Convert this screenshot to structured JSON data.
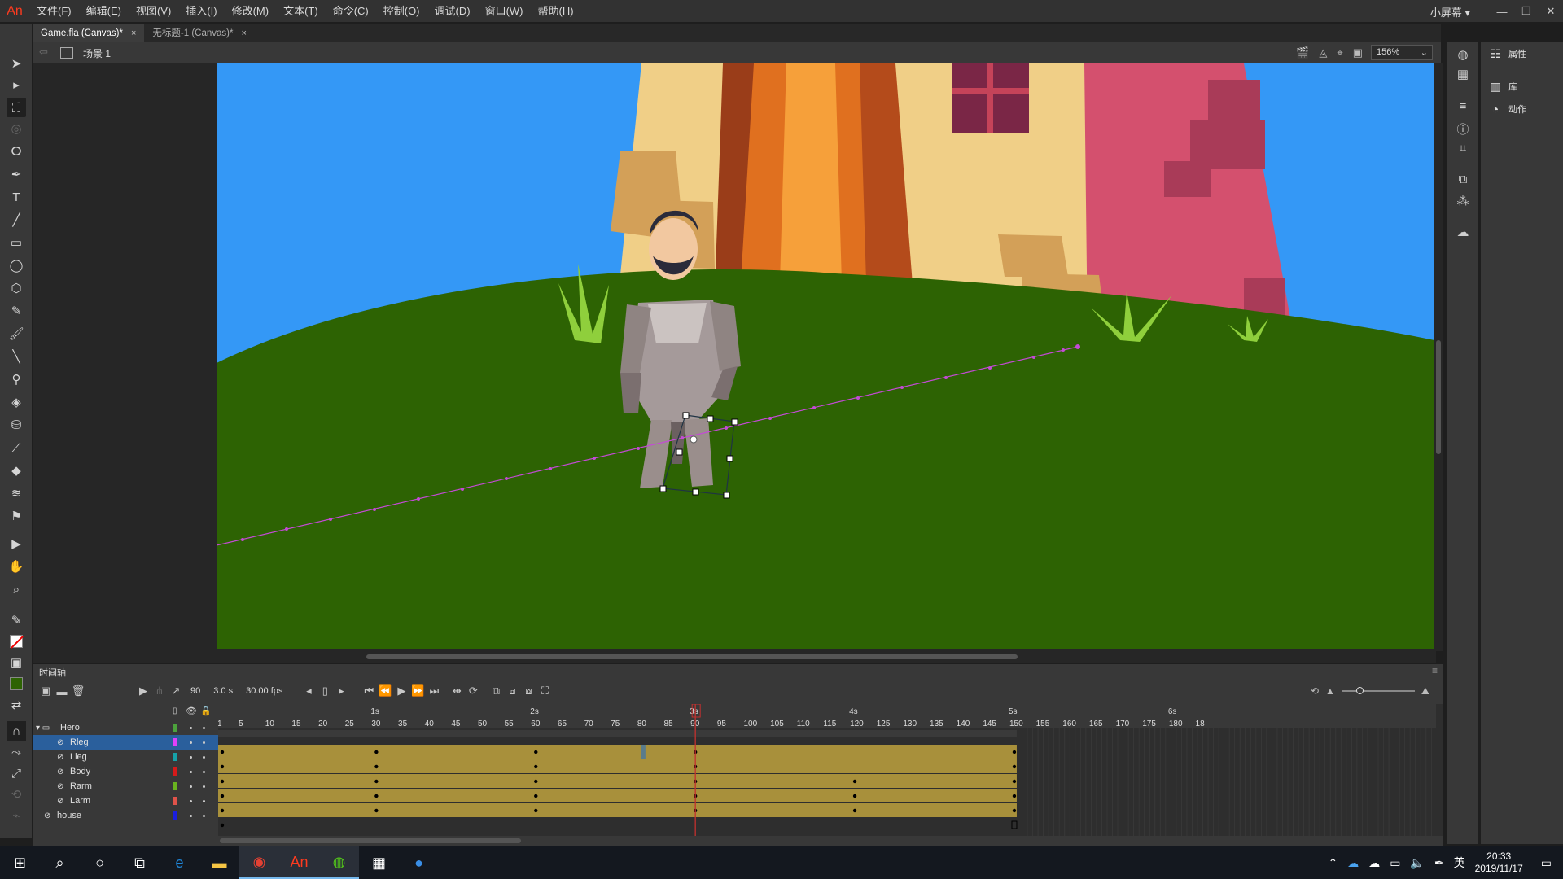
{
  "app": {
    "logo": "An"
  },
  "menu": [
    "文件(F)",
    "编辑(E)",
    "视图(V)",
    "插入(I)",
    "修改(M)",
    "文本(T)",
    "命令(C)",
    "控制(O)",
    "调试(D)",
    "窗口(W)",
    "帮助(H)"
  ],
  "workspace": "小屏幕",
  "window_buttons": [
    "—",
    "❐",
    "✕"
  ],
  "tabs": [
    {
      "label": "Game.fla (Canvas)*",
      "active": true
    },
    {
      "label": "无标题-1 (Canvas)*",
      "active": false
    }
  ],
  "tab_close": "×",
  "scene": {
    "label": "场景 1",
    "zoom": "156%"
  },
  "right_panel": {
    "items": [
      "属性",
      "库",
      "动作"
    ]
  },
  "timeline": {
    "title": "时间轴",
    "current_frame": "90",
    "time": "3.0 s",
    "fps": "30.00 fps",
    "seconds_labels": [
      "1s",
      "2s",
      "3s",
      "4s",
      "5s",
      "6s"
    ],
    "frame_labels": [
      "1",
      "5",
      "10",
      "15",
      "20",
      "25",
      "30",
      "35",
      "40",
      "45",
      "50",
      "55",
      "60",
      "65",
      "70",
      "75",
      "80",
      "85",
      "90",
      "95",
      "100",
      "105",
      "110",
      "115",
      "120",
      "125",
      "130",
      "135",
      "140",
      "145",
      "150",
      "155",
      "160",
      "165",
      "170",
      "175",
      "180",
      "18"
    ],
    "layers": [
      {
        "name": "Hero",
        "type": "folder",
        "color": "#4ca23c"
      },
      {
        "name": "Rleg",
        "type": "layer",
        "color": "#e040fb",
        "selected": true
      },
      {
        "name": "Lleg",
        "type": "layer",
        "color": "#16a2a8"
      },
      {
        "name": "Body",
        "type": "layer",
        "color": "#d61a1a"
      },
      {
        "name": "Rarm",
        "type": "layer",
        "color": "#69b31f"
      },
      {
        "name": "Larm",
        "type": "layer",
        "color": "#e0534a"
      },
      {
        "name": "house",
        "type": "layer",
        "color": "#1a1ee0"
      }
    ],
    "playhead_frame": 90,
    "total_tween_frames": 150
  },
  "taskbar": {
    "clock_time": "20:33",
    "clock_date": "2019/11/17",
    "ime": "英"
  },
  "colors": {
    "sky": "#3498f6",
    "grass": "#2d6303",
    "tween": "#a8903b",
    "motion_path": "#c44ad6",
    "accent": "#2a5f9c"
  }
}
